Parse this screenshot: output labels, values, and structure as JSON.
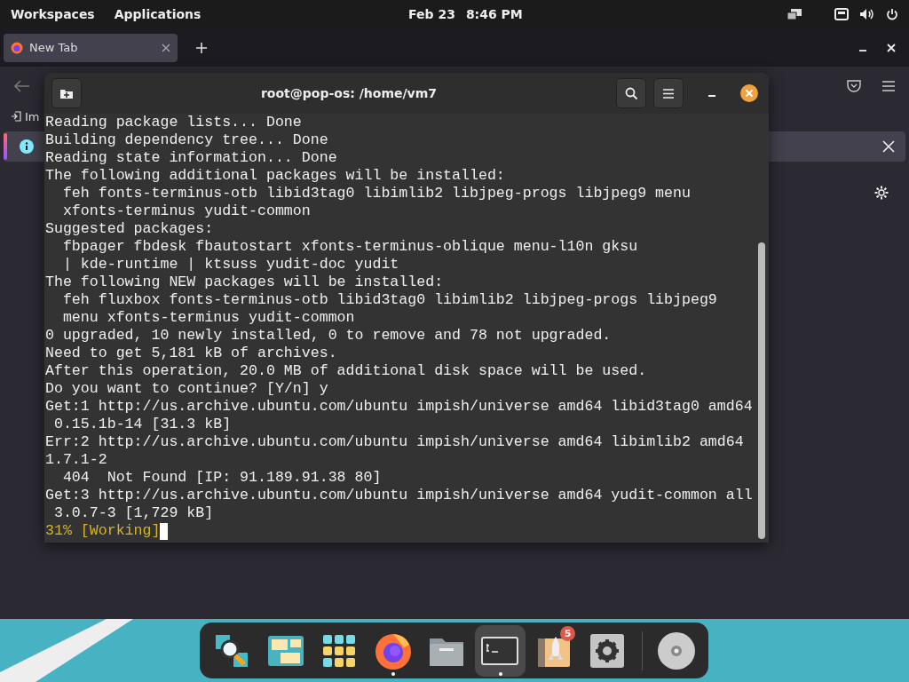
{
  "top_bar": {
    "left": [
      "Workspaces",
      "Applications"
    ],
    "date": "Feb 23",
    "time": "8:46 PM"
  },
  "browser": {
    "tabs": [
      {
        "label": "New Tab",
        "selected": true
      }
    ],
    "bookmark": "Im"
  },
  "terminal": {
    "title": "root@pop-os: /home/vm7",
    "lines": [
      {
        "kind": "text",
        "text": "Reading package lists... Done"
      },
      {
        "kind": "text",
        "text": "Building dependency tree... Done"
      },
      {
        "kind": "text",
        "text": "Reading state information... Done"
      },
      {
        "kind": "text",
        "text": "The following additional packages will be installed:"
      },
      {
        "kind": "text",
        "text": "  feh fonts-terminus-otb libid3tag0 libimlib2 libjpeg-progs libjpeg9 menu"
      },
      {
        "kind": "text",
        "text": "  xfonts-terminus yudit-common"
      },
      {
        "kind": "text",
        "text": "Suggested packages:"
      },
      {
        "kind": "text",
        "text": "  fbpager fbdesk fbautostart xfonts-terminus-oblique menu-l10n gksu"
      },
      {
        "kind": "text",
        "text": "  | kde-runtime | ktsuss yudit-doc yudit"
      },
      {
        "kind": "text",
        "text": "The following NEW packages will be installed:"
      },
      {
        "kind": "text",
        "text": "  feh fluxbox fonts-terminus-otb libid3tag0 libimlib2 libjpeg-progs libjpeg9"
      },
      {
        "kind": "text",
        "text": "  menu xfonts-terminus yudit-common"
      },
      {
        "kind": "text",
        "text": "0 upgraded, 10 newly installed, 0 to remove and 78 not upgraded."
      },
      {
        "kind": "text",
        "text": "Need to get 5,181 kB of archives."
      },
      {
        "kind": "text",
        "text": "After this operation, 20.0 MB of additional disk space will be used."
      },
      {
        "kind": "text",
        "text": "Do you want to continue? [Y/n] y"
      },
      {
        "kind": "text",
        "text": "Get:1 http://us.archive.ubuntu.com/ubuntu impish/universe amd64 libid3tag0 amd64"
      },
      {
        "kind": "text",
        "text": " 0.15.1b-14 [31.3 kB]"
      },
      {
        "kind": "text",
        "text": "Err:2 http://us.archive.ubuntu.com/ubuntu impish/universe amd64 libimlib2 amd64"
      },
      {
        "kind": "text",
        "text": "1.7.1-2"
      },
      {
        "kind": "text",
        "text": "  404  Not Found [IP: 91.189.91.38 80]"
      },
      {
        "kind": "text",
        "text": "Get:3 http://us.archive.ubuntu.com/ubuntu impish/universe amd64 yudit-common all"
      },
      {
        "kind": "text",
        "text": " 3.0.7-3 [1,729 kB]"
      },
      {
        "kind": "progress",
        "text": "31% [Working]"
      }
    ]
  },
  "dock": {
    "badge": "5"
  }
}
